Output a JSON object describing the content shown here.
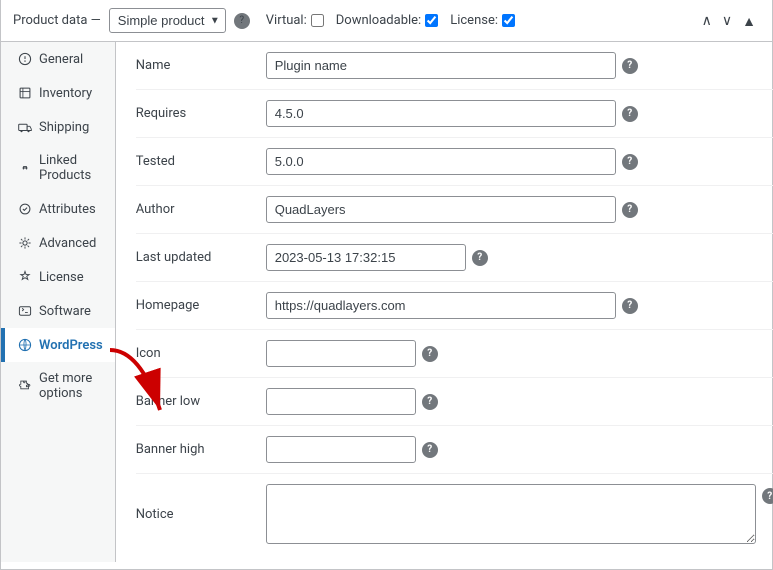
{
  "header": {
    "title": "Product data —",
    "product_type": "Simple product",
    "virtual_label": "Virtual:",
    "downloadable_label": "Downloadable:",
    "license_label": "License:",
    "virtual_checked": false,
    "downloadable_checked": true,
    "license_checked": true
  },
  "sidebar": {
    "items": [
      {
        "id": "general",
        "label": "General",
        "icon": "general"
      },
      {
        "id": "inventory",
        "label": "Inventory",
        "icon": "inventory"
      },
      {
        "id": "shipping",
        "label": "Shipping",
        "icon": "shipping"
      },
      {
        "id": "linked-products",
        "label": "Linked Products",
        "icon": "link"
      },
      {
        "id": "attributes",
        "label": "Attributes",
        "icon": "attributes"
      },
      {
        "id": "advanced",
        "label": "Advanced",
        "icon": "advanced"
      },
      {
        "id": "license",
        "label": "License",
        "icon": "license"
      },
      {
        "id": "software",
        "label": "Software",
        "icon": "software"
      },
      {
        "id": "wordpress",
        "label": "WordPress",
        "icon": "wordpress"
      },
      {
        "id": "get-more",
        "label": "Get more options",
        "icon": "puzzle"
      }
    ]
  },
  "form": {
    "fields": [
      {
        "label": "Name",
        "value": "Plugin name",
        "type": "text",
        "size": "wide",
        "help": true
      },
      {
        "label": "Requires",
        "value": "4.5.0",
        "type": "text",
        "size": "wide",
        "help": true
      },
      {
        "label": "Tested",
        "value": "5.0.0",
        "type": "text",
        "size": "wide",
        "help": true
      },
      {
        "label": "Author",
        "value": "QuadLayers",
        "type": "text",
        "size": "wide",
        "help": true
      },
      {
        "label": "Last updated",
        "value": "2023-05-13 17:32:15",
        "type": "text",
        "size": "medium",
        "help": true
      },
      {
        "label": "Homepage",
        "value": "https://quadlayers.com",
        "type": "text",
        "size": "wide",
        "help": true
      },
      {
        "label": "Icon",
        "value": "",
        "type": "text",
        "size": "narrow",
        "help": true
      },
      {
        "label": "Banner low",
        "value": "",
        "type": "text",
        "size": "narrow",
        "help": true
      },
      {
        "label": "Banner high",
        "value": "",
        "type": "text",
        "size": "narrow",
        "help": true
      },
      {
        "label": "Notice",
        "value": "",
        "type": "textarea",
        "size": "full",
        "help": true
      }
    ]
  }
}
